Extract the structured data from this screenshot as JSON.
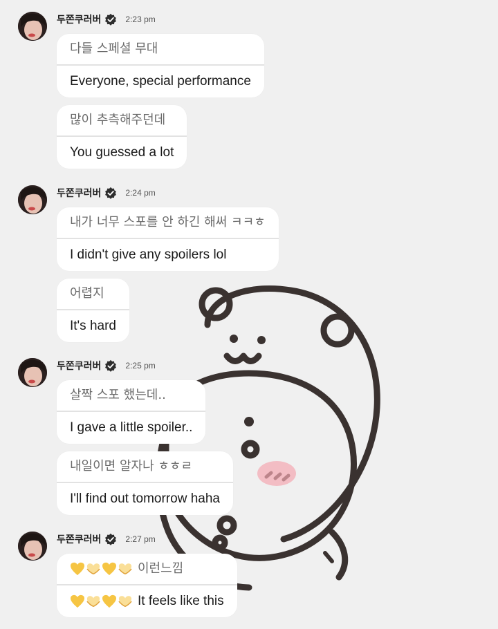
{
  "sender": {
    "name": "두쫀쿠러버",
    "verified_icon": "verified-badge-icon",
    "avatar_icon": "profile-photo"
  },
  "groups": [
    {
      "time": "2:23 pm",
      "messages": [
        {
          "original": "다들 스페셜 무대",
          "translation": "Everyone, special performance"
        },
        {
          "original": "많이 추측해주던데",
          "translation": "You guessed a lot"
        }
      ]
    },
    {
      "time": "2:24 pm",
      "messages": [
        {
          "original": "내가 너무 스포를 안 하긴 해써 ㅋㅋㅎ",
          "translation": "I didn't give any spoilers lol"
        },
        {
          "original": "어렵지",
          "translation": "It's hard"
        }
      ]
    },
    {
      "time": "2:25 pm",
      "messages": [
        {
          "original": "살짝 스포 했는데..",
          "translation": "I gave a little spoiler.."
        },
        {
          "original": "내일이면 알자나 ㅎㅎㄹ",
          "translation": "I'll find out tomorrow haha"
        }
      ]
    },
    {
      "time": "2:27 pm",
      "messages": [
        {
          "original": "이런느낌",
          "translation": "It feels like this",
          "emoji": [
            "yellow-heart",
            "heart-hands",
            "yellow-heart",
            "heart-hands"
          ]
        }
      ]
    }
  ],
  "colors": {
    "background": "#f0f0f0",
    "bubble": "#ffffff",
    "wallpaper_line": "#3a3230",
    "blush": "#f4a7b0",
    "yellow_heart": "#f6c543"
  }
}
